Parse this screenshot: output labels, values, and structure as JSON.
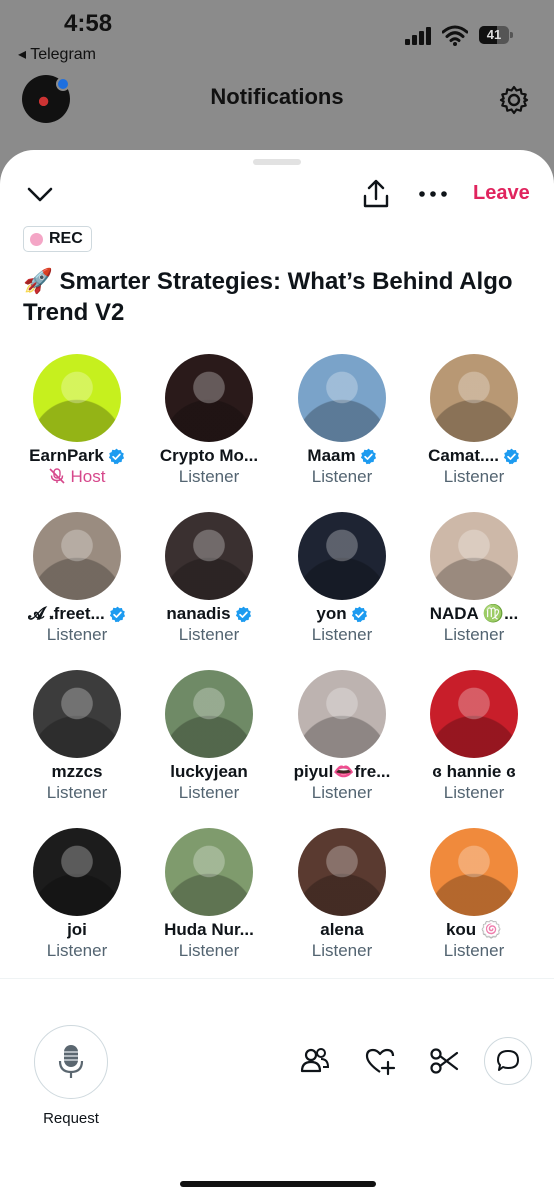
{
  "status": {
    "time": "4:58",
    "back_app": "◂ Telegram",
    "battery": "41"
  },
  "header": {
    "title": "Notifications"
  },
  "space": {
    "leave_label": "Leave",
    "rec_label": "REC",
    "title": "🚀 Smarter Strategies: What’s Behind Algo Trend V2"
  },
  "participants": [
    {
      "name": "EarnPark",
      "role": "Host",
      "verified": true,
      "avatar_bg": "#c6f01e"
    },
    {
      "name": "Crypto Mo...",
      "role": "Listener",
      "verified": false,
      "avatar_bg": "#2a1a1a"
    },
    {
      "name": "Maam",
      "role": "Listener",
      "verified": true,
      "avatar_bg": "#7aa3c9"
    },
    {
      "name": "Camat....",
      "role": "Listener",
      "verified": true,
      "avatar_bg": "#b89874"
    },
    {
      "name": "𝓐 ⸼freet...",
      "role": "Listener",
      "verified": true,
      "avatar_bg": "#9a8c80"
    },
    {
      "name": "nanadis",
      "role": "Listener",
      "verified": true,
      "avatar_bg": "#3a3030"
    },
    {
      "name": "yon",
      "role": "Listener",
      "verified": true,
      "avatar_bg": "#1e2433"
    },
    {
      "name": "NADA ♍...",
      "role": "Listener",
      "verified": false,
      "avatar_bg": "#cdb8a8"
    },
    {
      "name": "mzzcs",
      "role": "Listener",
      "verified": false,
      "avatar_bg": "#3c3c3c"
    },
    {
      "name": "luckyjean",
      "role": "Listener",
      "verified": false,
      "avatar_bg": "#6f8a66"
    },
    {
      "name": "piyul👄fre...",
      "role": "Listener",
      "verified": false,
      "avatar_bg": "#bdb3b0"
    },
    {
      "name": "ɞ hannie ɞ",
      "role": "Listener",
      "verified": false,
      "avatar_bg": "#c81e2a"
    },
    {
      "name": "joi",
      "role": "Listener",
      "verified": false,
      "avatar_bg": "#1c1c1c"
    },
    {
      "name": "Huda Nur...",
      "role": "Listener",
      "verified": false,
      "avatar_bg": "#7f9b6d"
    },
    {
      "name": "alena",
      "role": "Listener",
      "verified": false,
      "avatar_bg": "#5a3a30"
    },
    {
      "name": "kou 🍥",
      "role": "Listener",
      "verified": false,
      "avatar_bg": "#f08a3c"
    }
  ],
  "footer": {
    "request_label": "Request"
  },
  "colors": {
    "accent_red": "#e0245e",
    "verified_blue": "#1d9bf0",
    "host_pink": "#d6478b",
    "rec_dot": "#f4a6c6"
  },
  "icons": [
    "chevron-down-icon",
    "share-icon",
    "more-icon",
    "gear-icon",
    "microphone-icon",
    "people-icon",
    "heart-plus-icon",
    "scissors-icon",
    "chat-icon"
  ]
}
